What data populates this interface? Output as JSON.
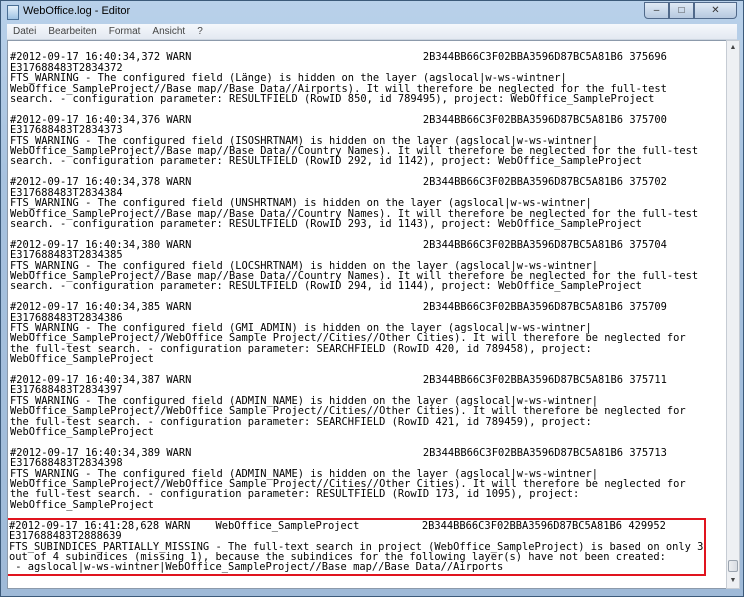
{
  "window": {
    "title": "WebOffice.log - Editor",
    "controls": {
      "minimize": "–",
      "maximize": "□",
      "close": "✕"
    }
  },
  "menu": [
    "Datei",
    "Bearbeiten",
    "Format",
    "Ansicht",
    "?"
  ],
  "scrollbar": {
    "up": "▲",
    "down": "▼",
    "position": 1.0
  },
  "highlight_color": "#e0141e",
  "entries": [
    {
      "lines": [
        "",
        "#2012-09-17 16:40:34,372 WARN                                     2B344BB66C3F02BBA3596D87BC5A81B6 375696",
        "E317688483T2834372",
        "FTS_WARNING - The configured field (Länge) is hidden on the layer (agslocal|w-ws-wintner|",
        "WebOffice_SampleProject//Base map//Base Data//Airports). It will therefore be neglected for the full-test",
        "search. - configuration parameter: RESULTFIELD (RowID 850, id 789495), project: WebOffice_SampleProject"
      ]
    },
    {
      "lines": [
        "",
        "#2012-09-17 16:40:34,376 WARN                                     2B344BB66C3F02BBA3596D87BC5A81B6 375700",
        "E317688483T2834373",
        "FTS_WARNING - The configured field (ISOSHRTNAM) is hidden on the layer (agslocal|w-ws-wintner|",
        "WebOffice_SampleProject//Base map//Base Data//Country Names). It will therefore be neglected for the full-test",
        "search. - configuration parameter: RESULTFIELD (RowID 292, id 1142), project: WebOffice_SampleProject"
      ]
    },
    {
      "lines": [
        "",
        "#2012-09-17 16:40:34,378 WARN                                     2B344BB66C3F02BBA3596D87BC5A81B6 375702",
        "E317688483T2834384",
        "FTS_WARNING - The configured field (UNSHRTNAM) is hidden on the layer (agslocal|w-ws-wintner|",
        "WebOffice_SampleProject//Base map//Base Data//Country Names). It will therefore be neglected for the full-test",
        "search. - configuration parameter: RESULTFIELD (RowID 293, id 1143), project: WebOffice_SampleProject"
      ]
    },
    {
      "lines": [
        "",
        "#2012-09-17 16:40:34,380 WARN                                     2B344BB66C3F02BBA3596D87BC5A81B6 375704",
        "E317688483T2834385",
        "FTS_WARNING - The configured field (LOCSHRTNAM) is hidden on the layer (agslocal|w-ws-wintner|",
        "WebOffice_SampleProject//Base map//Base Data//Country Names). It will therefore be neglected for the full-test",
        "search. - configuration parameter: RESULTFIELD (RowID 294, id 1144), project: WebOffice_SampleProject"
      ]
    },
    {
      "lines": [
        "",
        "#2012-09-17 16:40:34,385 WARN                                     2B344BB66C3F02BBA3596D87BC5A81B6 375709",
        "E317688483T2834386",
        "FTS_WARNING - The configured field (GMI_ADMIN) is hidden on the layer (agslocal|w-ws-wintner|",
        "WebOffice_SampleProject//WebOffice Sample Project//Cities//Other Cities). It will therefore be neglected for",
        "the full-test search. - configuration parameter: SEARCHFIELD (RowID 420, id 789458), project:",
        "WebOffice_SampleProject"
      ]
    },
    {
      "lines": [
        "",
        "#2012-09-17 16:40:34,387 WARN                                     2B344BB66C3F02BBA3596D87BC5A81B6 375711",
        "E317688483T2834397",
        "FTS_WARNING - The configured field (ADMIN_NAME) is hidden on the layer (agslocal|w-ws-wintner|",
        "WebOffice_SampleProject//WebOffice Sample Project//Cities//Other Cities). It will therefore be neglected for",
        "the full-test search. - configuration parameter: SEARCHFIELD (RowID 421, id 789459), project:",
        "WebOffice_SampleProject"
      ]
    },
    {
      "lines": [
        "",
        "#2012-09-17 16:40:34,389 WARN                                     2B344BB66C3F02BBA3596D87BC5A81B6 375713",
        "E317688483T2834398",
        "FTS_WARNING - The configured field (ADMIN_NAME) is hidden on the layer (agslocal|w-ws-wintner|",
        "WebOffice_SampleProject//WebOffice Sample Project//Cities//Other Cities). It will therefore be neglected for",
        "the full-test search. - configuration parameter: RESULTFIELD (RowID 173, id 1095), project:",
        "WebOffice_SampleProject",
        ""
      ]
    },
    {
      "highlight": true,
      "lines": [
        "#2012-09-17 16:41:28,628 WARN    WebOffice_SampleProject          2B344BB66C3F02BBA3596D87BC5A81B6 429952",
        "E317688483T2888639",
        "FTS_SUBINDICES_PARTIALLY_MISSING - The full-text search in project (WebOffice_SampleProject) is based on only 3",
        "out of 4 subindices (missing 1), because the subindices for the following layer(s) have not been created:",
        " - agslocal|w-ws-wintner|WebOffice_SampleProject//Base map//Base Data//Airports"
      ]
    }
  ]
}
